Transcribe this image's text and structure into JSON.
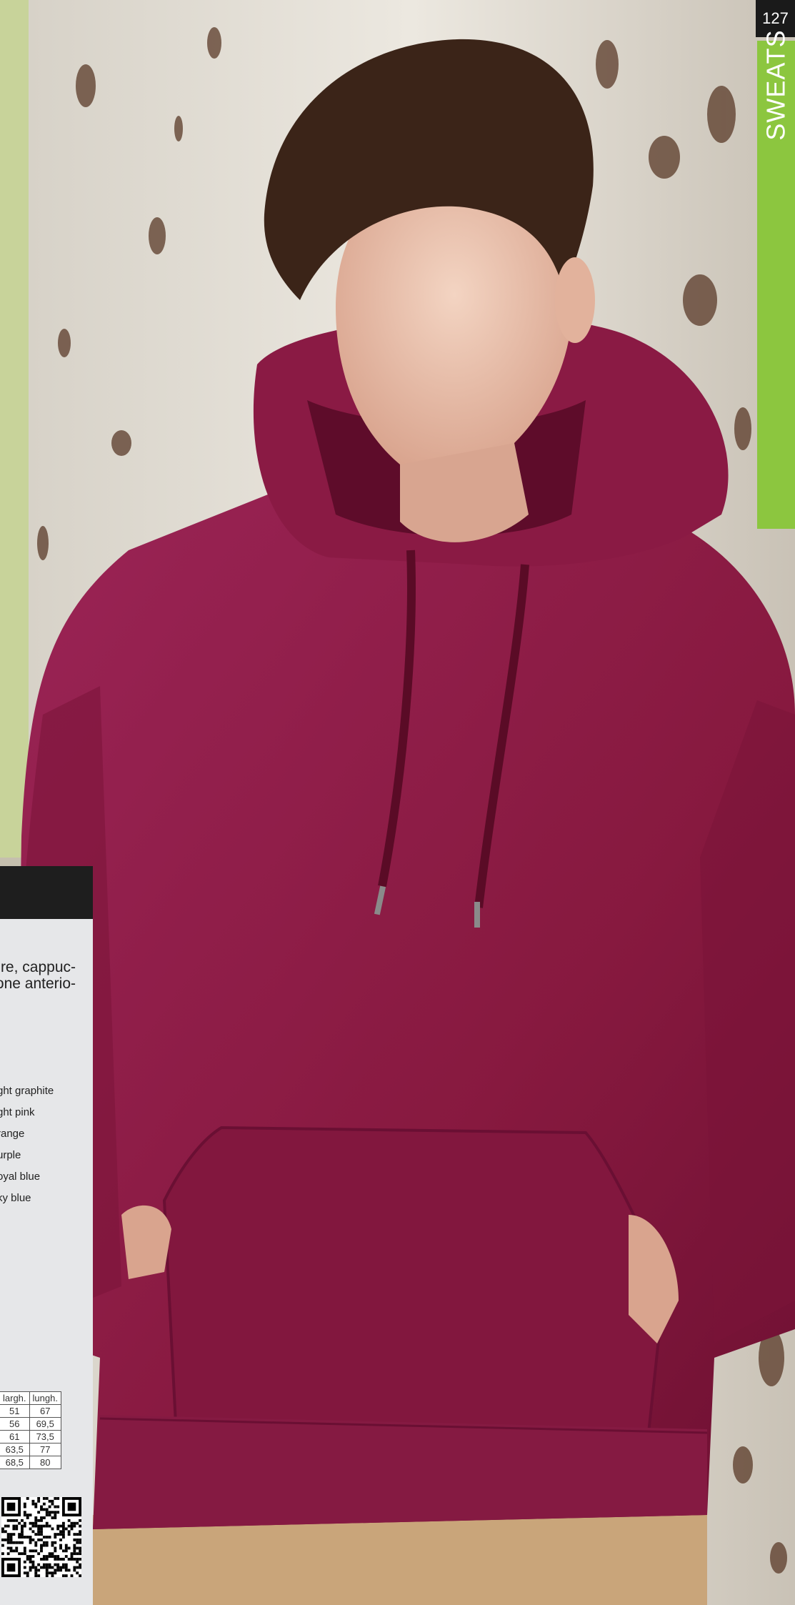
{
  "page": {
    "number": "127",
    "section": "SWEATS"
  },
  "panel": {
    "description_lines": [
      "re, cappuc-",
      "one anterio-"
    ],
    "colors": [
      "ght graphite",
      "ght pink",
      "range",
      "urple",
      "oyal blue",
      "ky blue"
    ]
  },
  "size_table": {
    "headers": [
      "",
      "largh.",
      "lungh."
    ],
    "rows": [
      [
        "",
        "51",
        "67"
      ],
      [
        "",
        "56",
        "69,5"
      ],
      [
        "",
        "61",
        "73,5"
      ],
      [
        "",
        "63,5",
        "77"
      ],
      [
        "",
        "68,5",
        "80"
      ]
    ]
  },
  "colors": {
    "accent": "#8cc63f",
    "hoodie": "#8e1f4c",
    "header": "#1e1e1e",
    "panel": "#e6e7e9"
  }
}
